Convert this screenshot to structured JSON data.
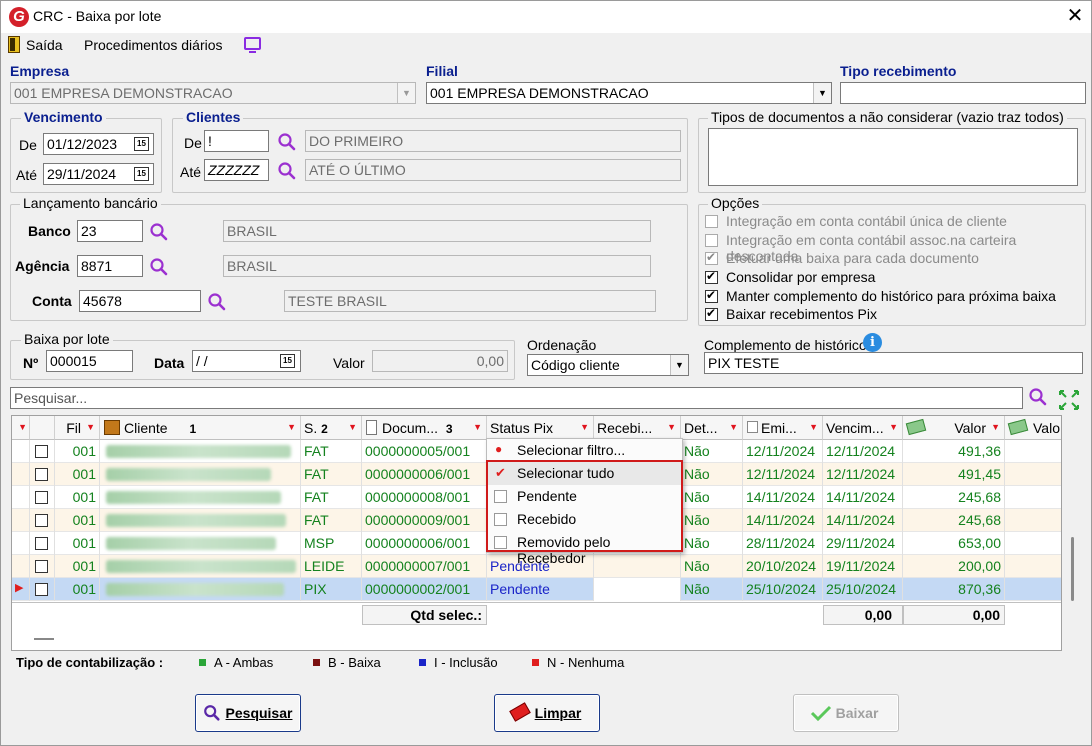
{
  "window": {
    "title": "CRC - Baixa por lote",
    "logo_letter": "G",
    "close": "✕"
  },
  "menu": {
    "saida": "Saída",
    "procedimentos": "Procedimentos diários"
  },
  "empresa": {
    "label": "Empresa",
    "value": "001 EMPRESA DEMONSTRACAO"
  },
  "filial": {
    "label": "Filial",
    "value": "001 EMPRESA DEMONSTRACAO"
  },
  "tipo_recebimento": {
    "label": "Tipo recebimento",
    "value": ""
  },
  "vencimento": {
    "title": "Vencimento",
    "de_label": "De",
    "de_value": "01/12/2023",
    "ate_label": "Até",
    "ate_value": "29/11/2024",
    "cal_glyph": "15"
  },
  "clientes": {
    "title": "Clientes",
    "de_label": "De",
    "de_value": "!",
    "de_name": "DO PRIMEIRO",
    "ate_label": "Até",
    "ate_value": "ZZZZZZ",
    "ate_name": "ATÉ O ÚLTIMO"
  },
  "tipos_docs": {
    "title": "Tipos de documentos a não considerar (vazio traz todos)",
    "value": ""
  },
  "lancamento": {
    "title": "Lançamento bancário",
    "banco_label": "Banco",
    "banco_value": "23",
    "banco_name": "BRASIL",
    "agencia_label": "Agência",
    "agencia_value": "8871",
    "agencia_name": "BRASIL",
    "conta_label": "Conta",
    "conta_value": "45678",
    "conta_name": "TESTE BRASIL"
  },
  "opcoes": {
    "title": "Opções",
    "items": [
      {
        "label": "Integração em conta contábil única de cliente",
        "checked": false,
        "disabled": true
      },
      {
        "label": "Integração em conta contábil assoc.na carteira descontada",
        "checked": false,
        "disabled": true
      },
      {
        "label": "Efetuar uma baixa para cada documento",
        "checked": true,
        "disabled": true
      },
      {
        "label": "Consolidar por empresa",
        "checked": true,
        "disabled": false
      },
      {
        "label": "Manter complemento do histórico para próxima baixa",
        "checked": true,
        "disabled": false
      },
      {
        "label": "Baixar recebimentos Pix",
        "checked": true,
        "disabled": false
      }
    ]
  },
  "baixa_lote": {
    "title": "Baixa por lote",
    "num_label": "Nº",
    "num_value": "000015",
    "data_label": "Data",
    "data_value": " / /",
    "valor_label": "Valor",
    "valor_value": "0,00"
  },
  "ordenacao": {
    "label": "Ordenação",
    "value": "Código cliente"
  },
  "complemento": {
    "label": "Complemento de histórico",
    "value": "PIX TESTE"
  },
  "search": {
    "placeholder": "Pesquisar..."
  },
  "grid": {
    "headers": {
      "fil": "Fil",
      "cliente": "Cliente",
      "cliente_sort": "1",
      "s": "S.",
      "s_sort": "2",
      "docum": "Docum...",
      "docum_sort": "3",
      "status_pix": "Status Pix",
      "recebi": "Recebi...",
      "det": "Det...",
      "emi": "Emi...",
      "vencim": "Vencim...",
      "valor": "Valor",
      "valo": "Valo"
    },
    "rows": [
      {
        "fil": "001",
        "s": "FAT",
        "doc": "0000000005/001",
        "status": "",
        "det": "Não",
        "emi": "12/11/2024",
        "venc": "12/11/2024",
        "valor": "491,36"
      },
      {
        "fil": "001",
        "s": "FAT",
        "doc": "0000000006/001",
        "status": "",
        "det": "Não",
        "emi": "12/11/2024",
        "venc": "12/11/2024",
        "valor": "491,45"
      },
      {
        "fil": "001",
        "s": "FAT",
        "doc": "0000000008/001",
        "status": "",
        "det": "Não",
        "emi": "14/11/2024",
        "venc": "14/11/2024",
        "valor": "245,68"
      },
      {
        "fil": "001",
        "s": "FAT",
        "doc": "0000000009/001",
        "status": "",
        "det": "Não",
        "emi": "14/11/2024",
        "venc": "14/11/2024",
        "valor": "245,68"
      },
      {
        "fil": "001",
        "s": "MSP",
        "doc": "0000000006/001",
        "status": "",
        "det": "Não",
        "emi": "28/11/2024",
        "venc": "29/11/2024",
        "valor": "653,00"
      },
      {
        "fil": "001",
        "s": "LEIDE",
        "doc": "0000000007/001",
        "status": "Pendente",
        "det": "Não",
        "emi": "20/10/2024",
        "venc": "19/11/2024",
        "valor": "200,00"
      },
      {
        "fil": "001",
        "s": "PIX",
        "doc": "0000000002/001",
        "status": "Pendente",
        "det": "Não",
        "emi": "25/10/2024",
        "venc": "25/10/2024",
        "valor": "870,36"
      }
    ],
    "footer": {
      "label": "Qtd selec.:",
      "total1": "0,00",
      "total2": "0,00"
    }
  },
  "filter_menu": {
    "items": [
      {
        "label": "Selecionar filtro...",
        "mark": "●"
      },
      {
        "label": "Selecionar tudo",
        "mark": "✔"
      },
      {
        "label": "Pendente",
        "mark": ""
      },
      {
        "label": "Recebido",
        "mark": ""
      },
      {
        "label": "Removido pelo Recebedor",
        "mark": ""
      }
    ]
  },
  "legend": {
    "title": "Tipo de contabilização :",
    "items": [
      {
        "label": "A - Ambas",
        "color": "#2aa538"
      },
      {
        "label": "B - Baixa",
        "color": "#7a1010"
      },
      {
        "label": "I - Inclusão",
        "color": "#1a24c8"
      },
      {
        "label": "N - Nenhuma",
        "color": "#e01e1e"
      }
    ]
  },
  "buttons": {
    "pesquisar": "Pesquisar",
    "limpar": "Limpar",
    "baixar": "Baixar"
  }
}
